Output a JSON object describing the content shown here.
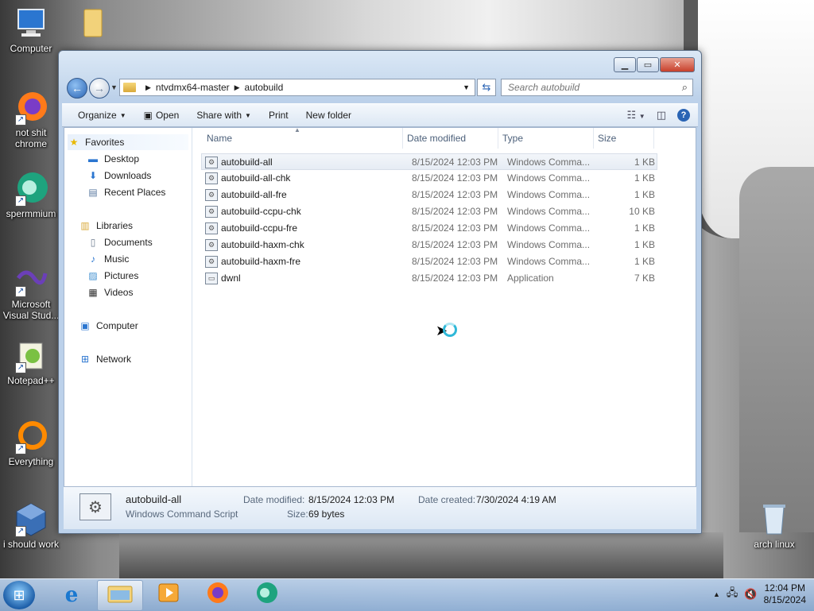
{
  "desktop": {
    "icons": [
      {
        "label": "Computer",
        "icon": "computer-icon"
      },
      {
        "label": "",
        "icon": "folder-icon"
      },
      {
        "label": "not shit chrome",
        "icon": "firefox-icon"
      },
      {
        "label": "spermmium",
        "icon": "spermmium-icon"
      },
      {
        "label": "Microsoft Visual Stud...",
        "icon": "visual-studio-icon"
      },
      {
        "label": "Notepad++",
        "icon": "notepadpp-icon"
      },
      {
        "label": "Everything",
        "icon": "everything-icon"
      },
      {
        "label": "i should work",
        "icon": "virtualbox-icon"
      },
      {
        "label": "arch linux",
        "icon": "recycle-bin-icon"
      }
    ]
  },
  "window": {
    "address": {
      "segments": [
        "ntvdmx64-master",
        "autobuild"
      ]
    },
    "search_placeholder": "Search autobuild",
    "toolbar": {
      "organize": "Organize",
      "open": "Open",
      "share_with": "Share with",
      "print": "Print",
      "new_folder": "New folder"
    },
    "nav": {
      "favorites": "Favorites",
      "desktop": "Desktop",
      "downloads": "Downloads",
      "recent_places": "Recent Places",
      "libraries": "Libraries",
      "documents": "Documents",
      "music": "Music",
      "pictures": "Pictures",
      "videos": "Videos",
      "computer": "Computer",
      "network": "Network"
    },
    "columns": {
      "name": "Name",
      "date": "Date modified",
      "type": "Type",
      "size": "Size"
    },
    "files": [
      {
        "name": "autobuild-all",
        "date": "8/15/2024 12:03 PM",
        "type": "Windows Comma...",
        "size": "1 KB"
      },
      {
        "name": "autobuild-all-chk",
        "date": "8/15/2024 12:03 PM",
        "type": "Windows Comma...",
        "size": "1 KB"
      },
      {
        "name": "autobuild-all-fre",
        "date": "8/15/2024 12:03 PM",
        "type": "Windows Comma...",
        "size": "1 KB"
      },
      {
        "name": "autobuild-ccpu-chk",
        "date": "8/15/2024 12:03 PM",
        "type": "Windows Comma...",
        "size": "10 KB"
      },
      {
        "name": "autobuild-ccpu-fre",
        "date": "8/15/2024 12:03 PM",
        "type": "Windows Comma...",
        "size": "1 KB"
      },
      {
        "name": "autobuild-haxm-chk",
        "date": "8/15/2024 12:03 PM",
        "type": "Windows Comma...",
        "size": "1 KB"
      },
      {
        "name": "autobuild-haxm-fre",
        "date": "8/15/2024 12:03 PM",
        "type": "Windows Comma...",
        "size": "1 KB"
      },
      {
        "name": "dwnl",
        "date": "8/15/2024 12:03 PM",
        "type": "Application",
        "size": "7 KB"
      }
    ],
    "details": {
      "name": "autobuild-all",
      "type": "Windows Command Script",
      "date_modified_label": "Date modified:",
      "date_modified": "8/15/2024 12:03 PM",
      "size_label": "Size:",
      "size": "69 bytes",
      "date_created_label": "Date created:",
      "date_created": "7/30/2024 4:19 AM"
    }
  },
  "taskbar": {
    "clock_time": "12:04 PM",
    "clock_date": "8/15/2024"
  }
}
